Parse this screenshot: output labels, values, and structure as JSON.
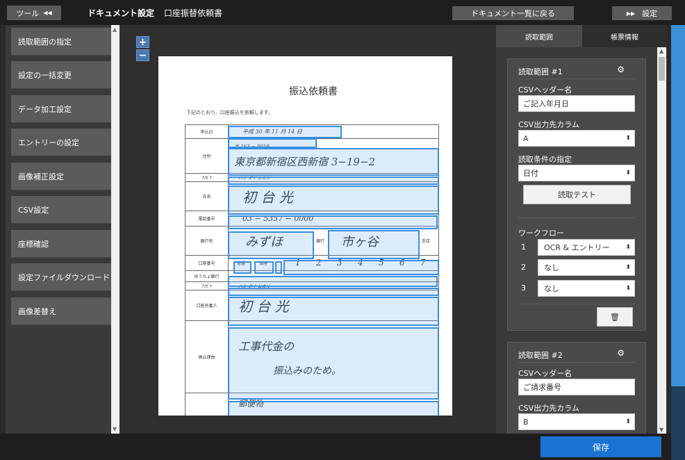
{
  "topbar": {
    "tools_label": "ツール",
    "tools_icon": "◀◀",
    "title": "ドキュメント設定",
    "document_name": "口座振替依頼書",
    "back_label": "ドキュメント一覧に戻る",
    "settings_icon": "▶▶",
    "settings_label": "設定"
  },
  "sidebar": {
    "items": [
      {
        "label": "読取範囲の指定"
      },
      {
        "label": "設定の一括変更"
      },
      {
        "label": "データ加工設定"
      },
      {
        "label": "エントリーの設定"
      },
      {
        "label": "画像補正設定"
      },
      {
        "label": "CSV設定"
      },
      {
        "label": "座標確認"
      },
      {
        "label": "設定ファイルダウンロード"
      },
      {
        "label": "画像差替え"
      }
    ]
  },
  "viewer": {
    "zoom_in": "+",
    "zoom_out": "−",
    "document": {
      "title": "振込依頼書",
      "intro": "下記のとおり、口座振込を依頼します。",
      "rows": {
        "apply_date_label": "申込日",
        "apply_date_value": "平成 30 年 11 月 14 日",
        "postal_value": "〒 163 − 8019",
        "address_label": "住所",
        "address_value": "東京都新宿区西新宿 3−19−2",
        "kana_label": "ﾌﾘｶﾞﾅ",
        "kana_value": "ハツ ダイ ヒカリ",
        "name_label": "氏名",
        "name_value": "初 台 光",
        "phone_label": "電話番号",
        "phone_value": "03 − 5357 − 0000",
        "bank_label": "銀行名",
        "bank_value": "みずほ",
        "bank_suffix": "銀行",
        "branch_value": "市ヶ谷",
        "branch_suffix": "支店",
        "account_no_label": "口座番号",
        "account_type_1": "普通",
        "account_type_2": "当座",
        "account_digits": [
          "1",
          "2",
          "3",
          "4",
          "5",
          "6",
          "7"
        ],
        "yucho_label": "ゆうちょ銀行",
        "yucho_value": "−",
        "kana2_label": "ﾌﾘｶﾞﾅ",
        "kana2_value": "ハツ ダイ ヒカリ",
        "holder_label": "口座名義人",
        "holder_value": "初 台 光",
        "reason_label": "振込理由",
        "reason_line1": "工事代金の",
        "reason_line2": "振込みのため。",
        "remarks_value": "郵便物"
      }
    }
  },
  "rightpanel": {
    "tabs": [
      {
        "label": "読取範囲"
      },
      {
        "label": "帳票情報"
      }
    ],
    "range1": {
      "title": "読取範囲 #1",
      "csv_header_label": "CSVヘッダー名",
      "csv_header_value": "ご記入年月日",
      "csv_column_label": "CSV出力先カラム",
      "csv_column_value": "A",
      "condition_label": "読取条件の指定",
      "condition_value": "日付",
      "test_button": "読取テスト",
      "workflow_label": "ワークフロー",
      "workflow": [
        {
          "num": "1",
          "value": "OCR & エントリー"
        },
        {
          "num": "2",
          "value": "なし"
        },
        {
          "num": "3",
          "value": "なし"
        }
      ],
      "trash_icon": "🗑"
    },
    "range2": {
      "title": "読取範囲 #2",
      "csv_header_label": "CSVヘッダー名",
      "csv_header_value": "ご請求番号",
      "csv_column_label": "CSV出力先カラム",
      "csv_column_value": "B"
    }
  },
  "bottombar": {
    "save_label": "保存"
  },
  "colors": {
    "accent": "#1a73d0",
    "selection": "#3b8de0"
  }
}
